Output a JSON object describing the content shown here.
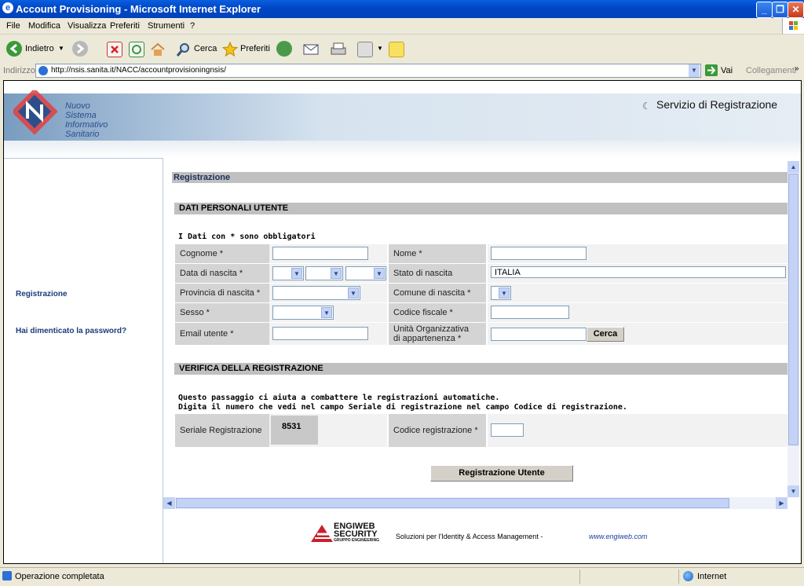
{
  "window": {
    "title": "Account Provisioning - Microsoft Internet Explorer"
  },
  "menu": [
    "File",
    "Modifica",
    "Visualizza",
    "Preferiti",
    "Strumenti",
    "?"
  ],
  "toolbar": {
    "back_label": "Indietro",
    "search_label": "Cerca",
    "favorites_label": "Preferiti"
  },
  "address": {
    "label": "Indirizzo",
    "url": "http://nsis.sanita.it/NACC/accountprovisioningnsis/",
    "go_label": "Vai",
    "links_label": "Collegamenti"
  },
  "banner": {
    "logo_line1": "Nuovo",
    "logo_line2": "Sistema",
    "logo_line3": "Informativo",
    "logo_line4": "Sanitario",
    "service_title": "Servizio di Registrazione"
  },
  "sidebar": {
    "link_registration": "Registrazione",
    "link_forgot": "Hai dimenticato la password?"
  },
  "form": {
    "page_header": "Registrazione",
    "section_personal": "DATI PERSONALI UTENTE",
    "required_note": "I Dati con * sono obbligatori",
    "labels": {
      "cognome": "Cognome *",
      "nome": "Nome *",
      "data_nascita": "Data di nascita *",
      "stato_nascita": "Stato di nascita",
      "provincia_nascita": "Provincia di nascita *",
      "comune_nascita": "Comune di nascita *",
      "sesso": "Sesso *",
      "codice_fiscale": "Codice fiscale *",
      "email": "Email utente *",
      "unita_line1": "Unità Organizzativa",
      "unita_line2": "di appartenenza *"
    },
    "values": {
      "stato_nascita": "ITALIA"
    },
    "cerca_button": "Cerca",
    "section_verify": "VERIFICA DELLA REGISTRAZIONE",
    "verify_text_1": "Questo passaggio ci aiuta a combattere le registrazioni automatiche.",
    "verify_text_2": "Digita il numero che vedi nel campo Seriale di registrazione nel campo Codice di registrazione.",
    "seriale_label": "Seriale Registrazione",
    "seriale_value": "8531",
    "codice_label": "Codice registrazione *",
    "submit_button": "Registrazione Utente"
  },
  "footer": {
    "brand_line1": "ENGIWEB",
    "brand_line2": "SECURITY",
    "brand_line3": "GRUPPO ENGINEERING",
    "tagline": "Soluzioni per l'Identity & Access Management  -",
    "link": "www.engiweb.com"
  },
  "status": {
    "left": "Operazione completata",
    "zone": "Internet"
  },
  "colors": {
    "titlebar": "#0048c8",
    "sidebar_link": "#1b3d7a",
    "section_bg": "#c0c0c0"
  }
}
